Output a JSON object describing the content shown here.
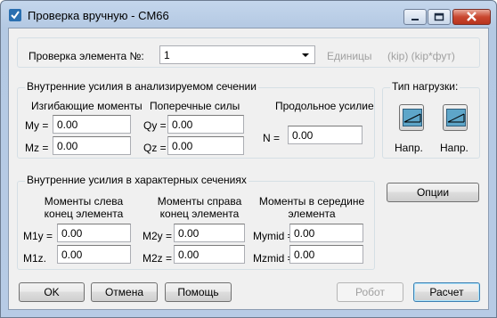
{
  "window": {
    "title": "Проверка вручную - CM66"
  },
  "element": {
    "label": "Проверка элемента №:",
    "selected": "1",
    "units_label": "Единицы",
    "units_value": "(kip) (kip*фут)"
  },
  "internal": {
    "legend": "Внутренние усилия в анализируемом сечении",
    "bending_header": "Изгибающие моменты",
    "shear_header": "Поперечные силы",
    "axial_header": "Продольное усилие",
    "my_label": "My =",
    "my_value": "0.00",
    "mz_label": "Mz =",
    "mz_value": "0.00",
    "qy_label": "Qy =",
    "qy_value": "0.00",
    "qz_label": "Qz =",
    "qz_value": "0.00",
    "n_label": "N =",
    "n_value": "0.00"
  },
  "load_type": {
    "legend": "Тип нагрузки:",
    "button1_label": "Напр.",
    "button2_label": "Напр.",
    "icon": "load-diagram-icon"
  },
  "characteristic": {
    "legend": "Внутренние усилия в характерных сечениях",
    "left_header_1": "Моменты слева",
    "left_header_2": "конец элемента",
    "right_header_1": "Моменты справа",
    "right_header_2": "конец элемента",
    "mid_header_1": "Моменты в середине",
    "mid_header_2": "элемента",
    "m1y_label": "M1y =",
    "m1y_value": "0.00",
    "m1z_label": "M1z.",
    "m1z_value": "0.00",
    "m2y_label": "M2y =",
    "m2y_value": "0.00",
    "m2z_label": "M2z =",
    "m2z_value": "0.00",
    "mymid_label": "Mymid =",
    "mymid_value": "0.00",
    "mzmid_label": "Mzmid =",
    "mzmid_value": "0.00"
  },
  "buttons": {
    "options": "Опции",
    "ok": "OK",
    "cancel": "Отмена",
    "help": "Помощь",
    "robot": "Робот",
    "calc": "Расчет"
  },
  "colors": {
    "accent": "#3c7fb1",
    "disabled": "#a0a0a0",
    "frame": "#b7cbe5"
  }
}
